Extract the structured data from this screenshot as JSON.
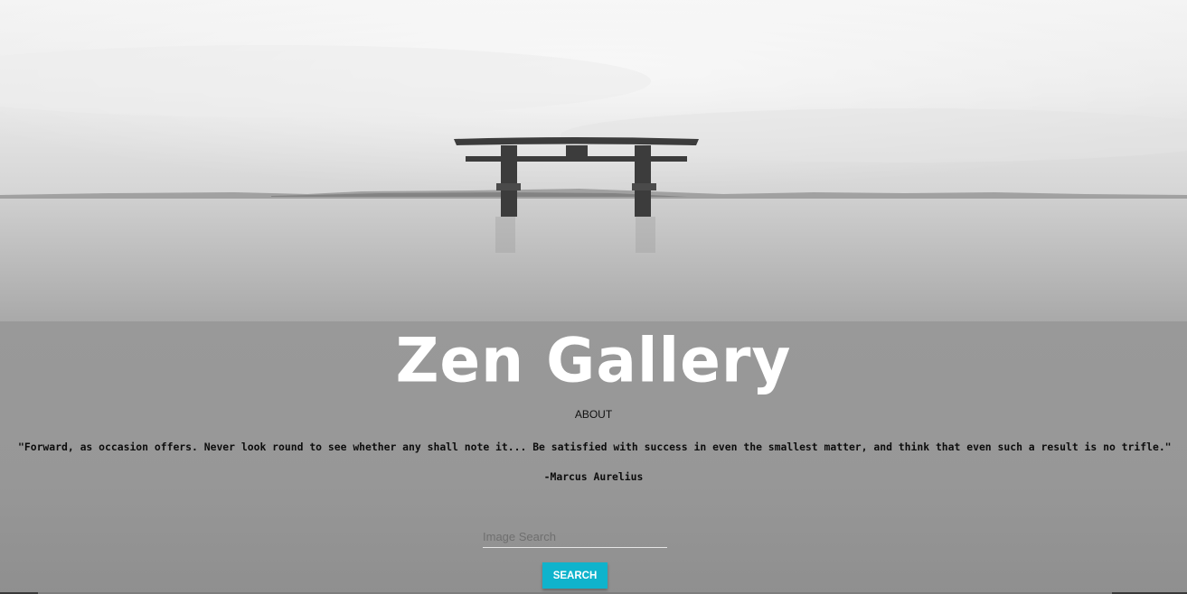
{
  "header": {
    "title": "Zen Gallery",
    "about_label": "ABOUT"
  },
  "hero": {
    "image_subject": "torii gate in misty lake"
  },
  "quote": {
    "text": "\"Forward, as occasion offers. Never look round to see whether any shall note it... Be satisfied with success in even the smallest matter, and think that even such a result is no trifle.\"",
    "author": "-Marcus Aurelius"
  },
  "search": {
    "placeholder": "Image Search",
    "value": "",
    "button_label": "SEARCH"
  },
  "colors": {
    "background": "#979797",
    "accent": "#0fb3cc",
    "title": "#ffffff"
  }
}
